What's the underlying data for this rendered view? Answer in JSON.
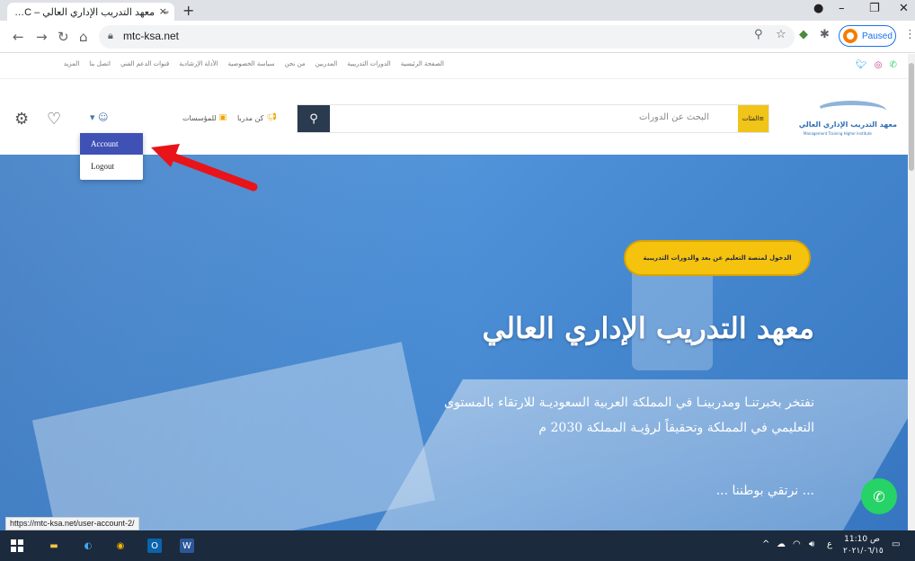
{
  "browser": {
    "tab_title": "معهد التدريب الإداري العالي – MTC",
    "tab_close": "×",
    "new_tab": "+",
    "url": "mtc-ksa.net",
    "profile_status": "Paused",
    "status_url": "https://mtc-ksa.net/user-account-2/"
  },
  "site": {
    "top_nav": [
      "الصفحة الرئيسية",
      "الدورات التدريبية",
      "المدربين",
      "من نحن",
      "سياسة الخصوصية",
      "الأدلة الإرشادية",
      "قنوات الدعم الفني",
      "اتصل بنا",
      "المزيد"
    ],
    "header": {
      "categories_label": "الفئات",
      "search_placeholder": "البحث عن الدورات",
      "be_trainer": "كن مدربا",
      "for_institutions": "للمؤسسات",
      "logo_name": "معهد التدريب الإداري العالي",
      "logo_sub": "Management Training Higher Institute"
    },
    "user_menu": {
      "items": [
        "Account",
        "Logout"
      ],
      "active": "Account"
    },
    "hero": {
      "cta": "الدخول لمنصة التعليم عن بعد والدورات التدريبية",
      "title": "معهد التدريب الإداري العالي",
      "description": "نفتخر بخبرتنـا ومدربينـا في المملكة العربية السعوديـة للارتقاء بالمستوى التعليمي في المملكة وتحقيقاً لرؤيـة المملكة 2030 م",
      "tagline": "... نرتقي بوطننا ..."
    }
  },
  "taskbar": {
    "time": "11:10 ص",
    "date": "٢٠٢١/٠٦/١٥"
  },
  "colors": {
    "accent_yellow": "#f5c20e",
    "dark_navy": "#2a3a4f",
    "menu_active": "#3f51b5",
    "whatsapp": "#25d366",
    "arrow": "#e8141a"
  }
}
